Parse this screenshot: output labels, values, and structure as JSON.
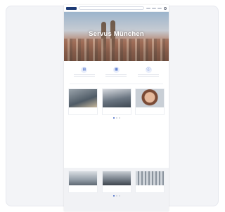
{
  "page": {
    "header": {
      "search_placeholder": ""
    },
    "hero": {
      "title": "Servus München"
    },
    "intro": {
      "kicker": "",
      "title": ""
    },
    "services": [
      {
        "label": "",
        "icon": "document-icon"
      },
      {
        "label": "",
        "icon": "calendar-icon"
      },
      {
        "label": "",
        "icon": "info-icon"
      }
    ],
    "section2": {
      "kicker": "",
      "title": "",
      "cards": [
        {
          "title": "",
          "link": ""
        },
        {
          "title": "",
          "link": ""
        },
        {
          "title": "",
          "link": ""
        }
      ]
    },
    "section3": {
      "kicker": "",
      "title": "",
      "cards": [
        {
          "title": "",
          "link": ""
        },
        {
          "title": "",
          "link": ""
        },
        {
          "title": "",
          "link": ""
        }
      ]
    }
  },
  "colors": {
    "brand_blue": "#1d3a75",
    "accent_blue": "#3b62c4",
    "accent_red": "#c0392b"
  }
}
